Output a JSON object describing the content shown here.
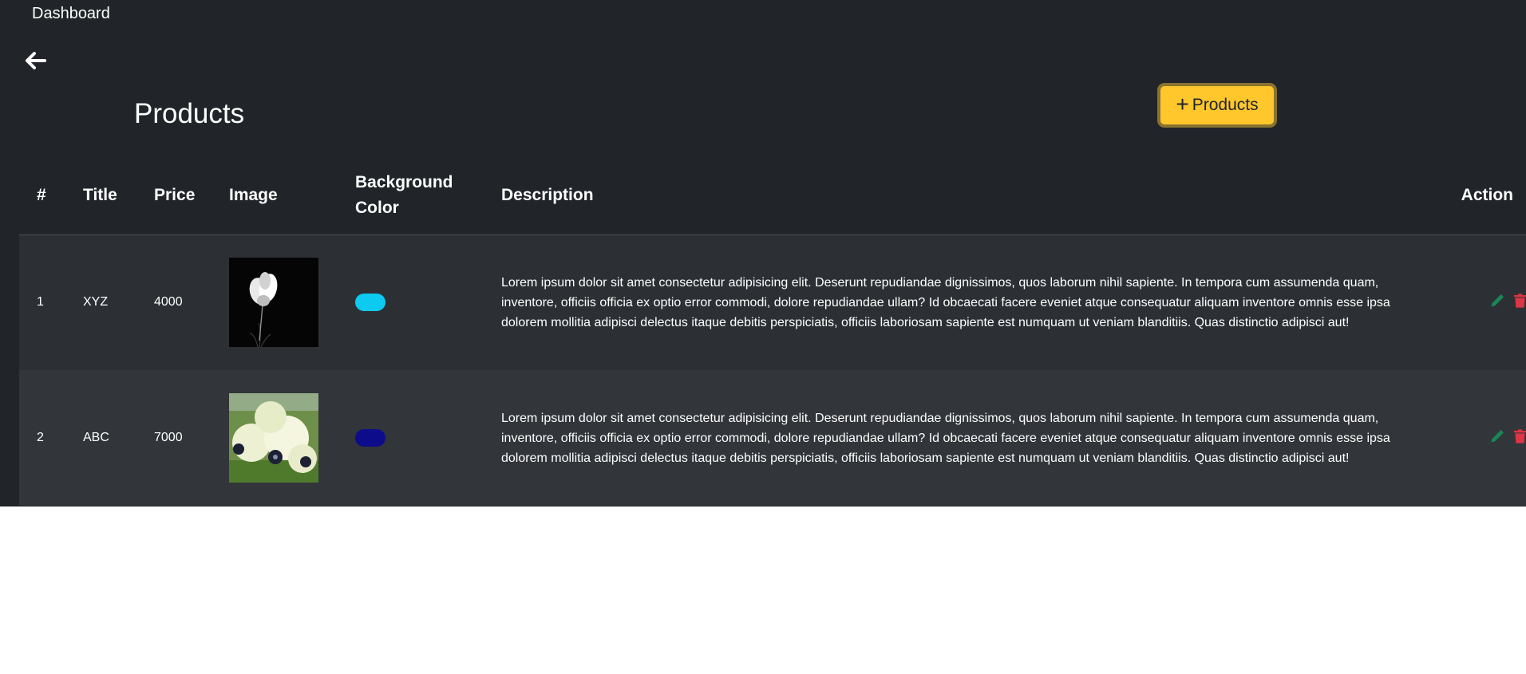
{
  "nav": {
    "brand": "Dashboard",
    "back_icon": "arrow-left-icon"
  },
  "page": {
    "title": "Products",
    "add_button_label": "Products",
    "add_button_icon": "plus-icon"
  },
  "table": {
    "headers": {
      "index": "#",
      "title": "Title",
      "price": "Price",
      "image": "Image",
      "background_color": "Background Color",
      "description": "Description",
      "action": "Action"
    },
    "rows": [
      {
        "index": "1",
        "title": "XYZ",
        "price": "4000",
        "image": "white-flower-dark-background",
        "background_color": "#0dcaf0",
        "description": "Lorem ipsum dolor sit amet consectetur adipisicing elit. Deserunt repudiandae dignissimos, quos laborum nihil sapiente. In tempora cum assumenda quam, inventore, officiis officia ex optio error commodi, dolore repudiandae ullam? Id obcaecati facere eveniet atque consequatur aliquam inventore omnis esse ipsa dolorem mollitia adipisci delectus itaque debitis perspiciatis, officiis laboriosam sapiente est numquam ut veniam blanditiis. Quas distinctio adipisci aut!"
      },
      {
        "index": "2",
        "title": "ABC",
        "price": "7000",
        "image": "white-anemone-flowers",
        "background_color": "#0d0d8c",
        "description": "Lorem ipsum dolor sit amet consectetur adipisicing elit. Deserunt repudiandae dignissimos, quos laborum nihil sapiente. In tempora cum assumenda quam, inventore, officiis officia ex optio error commodi, dolore repudiandae ullam? Id obcaecati facere eveniet atque consequatur aliquam inventore omnis esse ipsa dolorem mollitia adipisci delectus itaque debitis perspiciatis, officiis laboriosam sapiente est numquam ut veniam blanditiis. Quas distinctio adipisci aut!"
      }
    ],
    "action_icons": {
      "edit": "pencil-icon",
      "delete": "trash-icon"
    }
  },
  "colors": {
    "panel_background": "#212529",
    "button_accent": "#ffc72c",
    "edit_icon": "#198754",
    "delete_icon": "#dc3545"
  }
}
